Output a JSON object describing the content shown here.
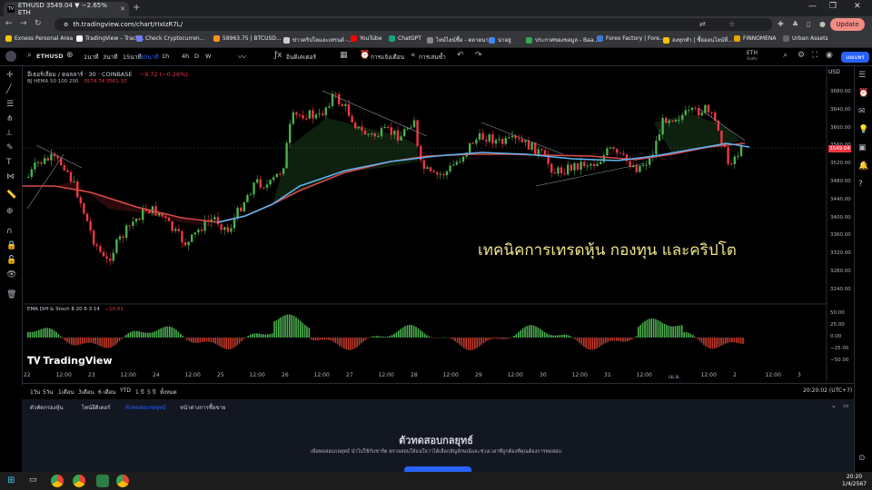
{
  "browser": {
    "tab_title": "ETHUSD 3549.04 ▼ −2.65% ETH",
    "tab_favicon": "TV",
    "url": "th.tradingview.com/chart/rIxIzR7L/",
    "update_label": "Update",
    "bookmarks": [
      {
        "label": "Exness Personal Area",
        "color": "#f5c400"
      },
      {
        "label": "TradingView – Track...",
        "color": "#ffffff"
      },
      {
        "label": "Check Cryptocurren...",
        "color": "#6f7dff"
      },
      {
        "label": "58963.75 | BTCUSD...",
        "color": "#f7931a"
      },
      {
        "label": "ข่าวคริปโตและเทรนด์ -...",
        "color": "#cccccc"
      },
      {
        "label": "YouTube",
        "color": "#ff0000"
      },
      {
        "label": "ChatGPT",
        "color": "#10a37f"
      },
      {
        "label": "ไทม์ไลน์ซื้อ - ตลาดนา...",
        "color": "#888888"
      },
      {
        "label": "น่าอยู่",
        "color": "#4285f4"
      },
      {
        "label": "ประกาศของขอมูล - Baa...",
        "color": "#34a853"
      },
      {
        "label": "Forex Factory | Fore...",
        "color": "#3a7bd5"
      },
      {
        "label": "ลงทุกทำ | ซื้อออนไลน์ที่...",
        "color": "#f5c400"
      },
      {
        "label": "FINNOMENA",
        "color": "#e8a400"
      },
      {
        "label": "Urban Assets",
        "color": "#666666"
      }
    ]
  },
  "toolbar": {
    "symbol": "ETHUSD",
    "intervals": [
      "1นาที",
      "3นาที",
      "15นาที",
      "30นาที",
      "1h",
      "4h",
      "D",
      "W"
    ],
    "active_interval": "30นาที",
    "indicators_label": "อินดิเคเตอร์",
    "alert_label": "การแจ้งเตือน",
    "replay_label": "การเล่นซ้ำ",
    "watchlist_label": "ETH",
    "watchlist_sub": "อันดับ",
    "publish_label": "เผยแพร่"
  },
  "chart": {
    "symbol_line": "อีเธอร์เลียม / ดอลลาร์ · 30 · COINBASE",
    "change": "−9.72 (−0.26%)",
    "indicator_line": "BJ HEMA  50 100 200",
    "indicator_values": "3574.74  3561.15",
    "currency": "USD",
    "last_price": "3549.04",
    "overlay_text": "เทคนิคการเทรดหุ้น กองทุน และคริปโต",
    "lower_indicator": "EMA Diff & Stoch  8 20 6 3 14",
    "lower_value": "−10.01",
    "logo_text": "TradingView",
    "y_labels": [
      "3680.00",
      "3640.00",
      "3600.00",
      "3560.00",
      "3520.00",
      "3480.00",
      "3440.00",
      "3400.00",
      "3360.00",
      "3320.00",
      "3280.00",
      "3240.00"
    ],
    "y2_labels": [
      "50.00",
      "25.00",
      "0.00",
      "−25.00",
      "−50.00"
    ],
    "x_labels": [
      "22",
      "12:00",
      "23",
      "12:00",
      "24",
      "12:00",
      "25",
      "12:00",
      "26",
      "12:00",
      "27",
      "12:00",
      "28",
      "12:00",
      "29",
      "12:00",
      "30",
      "12:00",
      "31",
      "12:00",
      "เม.ย.",
      "12:00",
      "2",
      "12:00",
      "3"
    ]
  },
  "bottom_bar": {
    "ranges": [
      "1วัน",
      "5วัน",
      "1เดือน",
      "3เดือน",
      "6 เดือน",
      "YTD",
      "1 ปี",
      "5 ปี",
      "ทั้งหมด"
    ],
    "time": "20:20:02 (UTC+7)"
  },
  "panel_tabs": [
    "ตัวคัดกรองหุ้น",
    "ไพน์อีดิเตอร์",
    "ตัวทดสอบกลยุทธ์",
    "หน้าต่างการซื้อขาย"
  ],
  "active_panel_tab": "ตัวทดสอบกลยุทธ์",
  "panel": {
    "title": "ตัวทดสอบกลยุทธ์",
    "description": "เพื่อทดสอบกลยุทธ์ นำไปใช้กับชาร์ต ตรวจสอบให้แน่ใจว่าได้เลือกสัญลักษณ์และช่วงเวลาที่ถูกต้องที่คุณต้องการทดสอบ"
  },
  "taskbar": {
    "time": "20:20",
    "date": "1/4/2567"
  },
  "colors": {
    "up": "#4caf50",
    "down": "#f23645",
    "ema_blue": "#5fb3f0",
    "ema_red": "#d84a4a",
    "overlay": "#f0e68c",
    "accent": "#2962ff"
  }
}
